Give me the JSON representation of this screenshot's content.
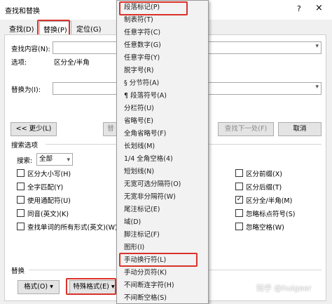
{
  "window": {
    "title": "查找和替换",
    "help": "?",
    "close": "×"
  },
  "tabs": [
    {
      "label": "查找(D)"
    },
    {
      "label": "替换(P)"
    },
    {
      "label": "定位(G)"
    }
  ],
  "find": {
    "label": "查找内容(N):",
    "options_label": "选项:",
    "options_value": "区分全/半角"
  },
  "replace": {
    "label": "替换为(I):"
  },
  "buttons": {
    "less": "<< 更少(L)",
    "replace_partial": "替",
    "find_next": "查找下一处(F)",
    "cancel": "取消",
    "format": "格式(O)",
    "special": "特殊格式(E)"
  },
  "search_options": {
    "title": "搜索选项",
    "search_label": "搜索:",
    "search_value": "全部"
  },
  "checkboxes_left": [
    {
      "label": "区分大小写(H)",
      "checked": false
    },
    {
      "label": "全字匹配(Y)",
      "checked": false
    },
    {
      "label": "使用通配符(U)",
      "checked": false
    },
    {
      "label": "同音(英文)(K)",
      "checked": false
    },
    {
      "label": "查找单词的所有形式(英文)(W)",
      "checked": false
    }
  ],
  "checkboxes_right": [
    {
      "label": "区分前缀(X)",
      "checked": false
    },
    {
      "label": "区分后缀(T)",
      "checked": false
    },
    {
      "label": "区分全/半角(M)",
      "checked": true
    },
    {
      "label": "忽略标点符号(S)",
      "checked": false
    },
    {
      "label": "忽略空格(W)",
      "checked": false
    }
  ],
  "replace_section": {
    "title": "替换"
  },
  "special_menu": {
    "items": [
      "段落标记(P)",
      "制表符(T)",
      "任意字符(C)",
      "任意数字(G)",
      "任意字母(Y)",
      "脱字号(R)",
      "§ 分节符(A)",
      "¶ 段落符号(A)",
      "分栏符(U)",
      "省略号(E)",
      "全角省略号(F)",
      "长划线(M)",
      "1/4 全角空格(4)",
      "短划线(N)",
      "无宽可选分隔符(O)",
      "无宽非分隔符(W)",
      "尾注标记(E)",
      "域(D)",
      "脚注标记(F)",
      "图形(I)",
      "手动换行符(L)",
      "手动分页符(K)",
      "不间断连字符(H)",
      "不间断空格(S)"
    ]
  },
  "watermark": "知乎 @huigeer"
}
